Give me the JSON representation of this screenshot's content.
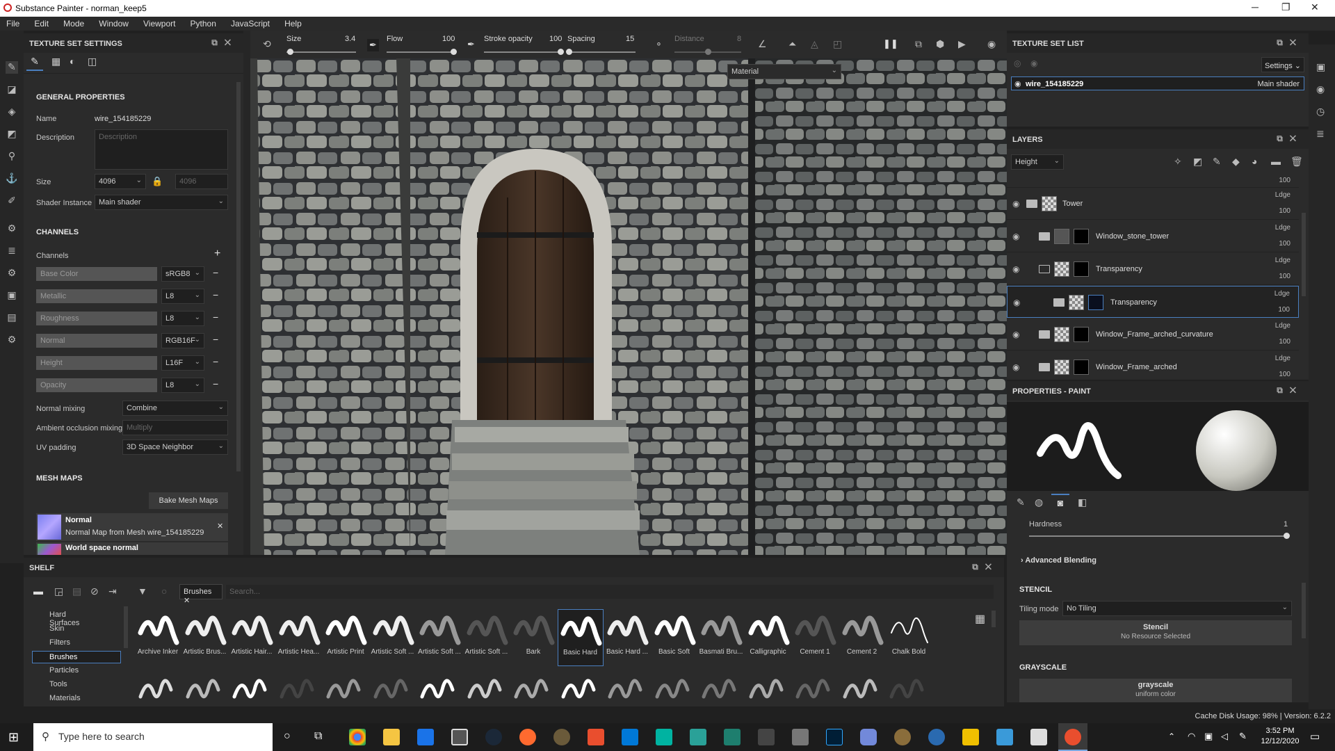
{
  "window": {
    "title": "Substance Painter - norman_keep5"
  },
  "menu": [
    "File",
    "Edit",
    "Mode",
    "Window",
    "Viewport",
    "Python",
    "JavaScript",
    "Help"
  ],
  "texture_set_settings": {
    "title": "TEXTURE SET SETTINGS",
    "general_title": "GENERAL PROPERTIES",
    "name_label": "Name",
    "name_value": "wire_154185229",
    "description_label": "Description",
    "description_placeholder": "Description",
    "size_label": "Size",
    "size_value": "4096",
    "size_value2": "4096",
    "shader_label": "Shader Instance",
    "shader_value": "Main shader",
    "channels_title": "CHANNELS",
    "channels_label": "Channels",
    "channels": [
      {
        "name": "Base Color",
        "format": "sRGB8"
      },
      {
        "name": "Metallic",
        "format": "L8"
      },
      {
        "name": "Roughness",
        "format": "L8"
      },
      {
        "name": "Normal",
        "format": "RGB16F"
      },
      {
        "name": "Height",
        "format": "L16F"
      },
      {
        "name": "Opacity",
        "format": "L8"
      }
    ],
    "normal_mixing_label": "Normal mixing",
    "normal_mixing_value": "Combine",
    "ao_mixing_label": "Ambient occlusion mixing",
    "ao_mixing_value": "Multiply",
    "uv_padding_label": "UV padding",
    "uv_padding_value": "3D Space Neighbor",
    "mesh_maps_title": "MESH MAPS",
    "bake_button": "Bake Mesh Maps",
    "mesh_map_1_name": "Normal",
    "mesh_map_1_desc": "Normal Map from Mesh wire_154185229",
    "mesh_map_2_name": "World space normal"
  },
  "topbar": {
    "size_label": "Size",
    "size_value": "3.4",
    "flow_label": "Flow",
    "flow_value": "100",
    "stroke_label": "Stroke opacity",
    "stroke_value": "100",
    "spacing_label": "Spacing",
    "spacing_value": "15",
    "distance_label": "Distance",
    "distance_value": "8",
    "size_level": 0.05,
    "flow_level": 1.0,
    "stroke_level": 1.0,
    "spacing_level": 0.02,
    "distance_level": 0.5
  },
  "viewport": {
    "display_mode": "Material"
  },
  "texture_set_list": {
    "title": "TEXTURE SET LIST",
    "settings_button": "Settings",
    "item": "wire_154185229",
    "item_shader": "Main shader"
  },
  "layers": {
    "title": "LAYERS",
    "channel": "Height",
    "top_opacity": "100",
    "items": [
      {
        "name": "Tower",
        "mode": "Ldge",
        "opacity": "100"
      },
      {
        "name": "Window_stone_tower",
        "mode": "Ldge",
        "opacity": "100"
      },
      {
        "name": "Transparency",
        "mode": "Ldge",
        "opacity": "100"
      },
      {
        "name": "Transparency",
        "mode": "Ldge",
        "opacity": "100"
      },
      {
        "name": "Window_Frame_arched_curvature",
        "mode": "Ldge",
        "opacity": "100"
      },
      {
        "name": "Window_Frame_arched",
        "mode": "Ldge",
        "opacity": "100"
      }
    ]
  },
  "properties": {
    "title": "PROPERTIES - PAINT",
    "hardness_label": "Hardness",
    "hardness_value": "1",
    "hardness_level": 1.0,
    "advanced_blending": "Advanced Blending",
    "stencil_title": "STENCIL",
    "tiling_label": "Tiling mode",
    "tiling_value": "No Tiling",
    "stencil_button": "Stencil",
    "stencil_sub": "No Resource Selected",
    "grayscale_title": "GRAYSCALE",
    "grayscale_button": "grayscale",
    "grayscale_sub": "uniform color"
  },
  "status": {
    "text": "Cache Disk Usage:  98% | Version: 6.2.2"
  },
  "shelf": {
    "title": "SHELF",
    "filter_tag": "Brushes",
    "search_placeholder": "Search...",
    "categories": [
      "Hard Surfaces",
      "Skin",
      "Filters",
      "Brushes",
      "Particles",
      "Tools",
      "Materials"
    ],
    "brushes": [
      "Archive Inker",
      "Artistic Brus...",
      "Artistic Hair...",
      "Artistic Hea...",
      "Artistic Print",
      "Artistic Soft ...",
      "Artistic Soft ...",
      "Artistic Soft ...",
      "Bark",
      "Basic Hard",
      "Basic Hard ...",
      "Basic Soft",
      "Basmati Bru...",
      "Calligraphic",
      "Cement 1",
      "Cement 2",
      "Chalk Bold"
    ]
  },
  "taskbar": {
    "search_placeholder": "Type here to search",
    "time": "3:52 PM",
    "date": "12/12/2020"
  }
}
